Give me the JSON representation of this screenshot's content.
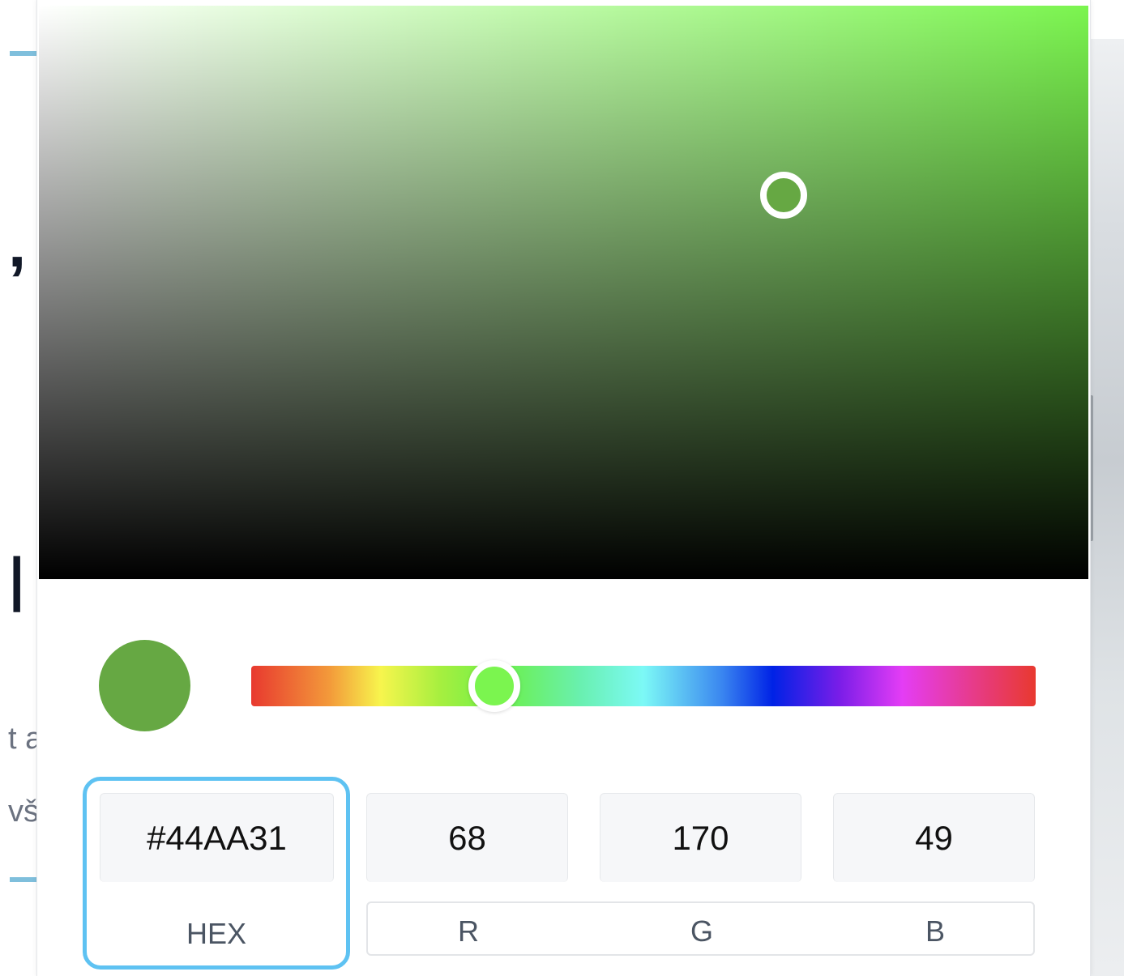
{
  "background_page": {
    "glyphs": [
      ",",
      "l",
      "t a",
      "vš"
    ]
  },
  "colors": {
    "selected_hex": "#66A843",
    "hue_color": "#7BF54F",
    "input_focus_border": "#5EC2F2",
    "label_text": "#4B5563"
  },
  "picker": {
    "saturation": 0.71,
    "brightness": 0.67,
    "hue_position": 0.31,
    "hex": {
      "value": "#44AA31",
      "label": "HEX"
    },
    "rgb": {
      "r": {
        "value": "68",
        "label": "R"
      },
      "g": {
        "value": "170",
        "label": "G"
      },
      "b": {
        "value": "49",
        "label": "B"
      }
    }
  }
}
